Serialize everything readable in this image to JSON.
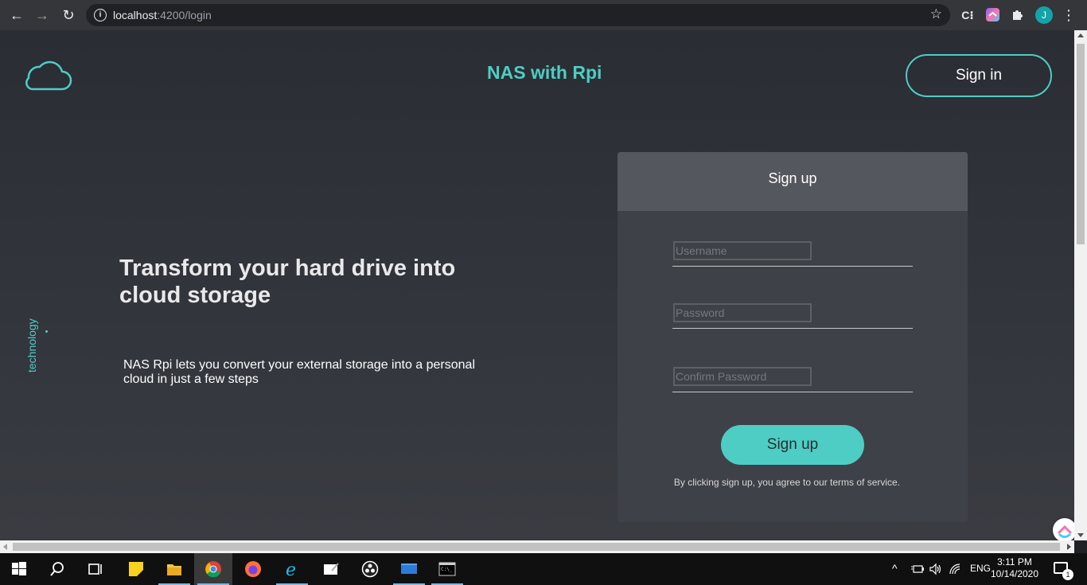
{
  "browser": {
    "back_icon": "←",
    "forward_icon": "→",
    "reload_icon": "↻",
    "url_host": "localhost",
    "url_rest": ":4200/login",
    "star_icon": "☆",
    "ext_c_label": "C⁝",
    "avatar_letter": "J",
    "menu_icon": "⋮"
  },
  "header": {
    "brand": "NAS with Rpi",
    "signin_label": "Sign in"
  },
  "hero": {
    "vertical_tag": "technology",
    "headline": "Transform your hard drive into cloud storage",
    "subtext": "NAS Rpi lets you convert your external storage into a personal cloud in just a few steps"
  },
  "signup_card": {
    "title": "Sign up",
    "username_placeholder": "Username",
    "password_placeholder": "Password",
    "confirm_placeholder": "Confirm Password",
    "submit_label": "Sign up",
    "terms": "By clicking sign up, you agree to our terms of service."
  },
  "taskbar": {
    "language": "ENG",
    "time": "3:11 PM",
    "date": "10/14/2020",
    "notification_count": "1"
  },
  "colors": {
    "accent": "#4ecdc4",
    "page_bg": "#2a2d33",
    "card_bg": "#3f4148",
    "card_header_bg": "#55575e"
  }
}
